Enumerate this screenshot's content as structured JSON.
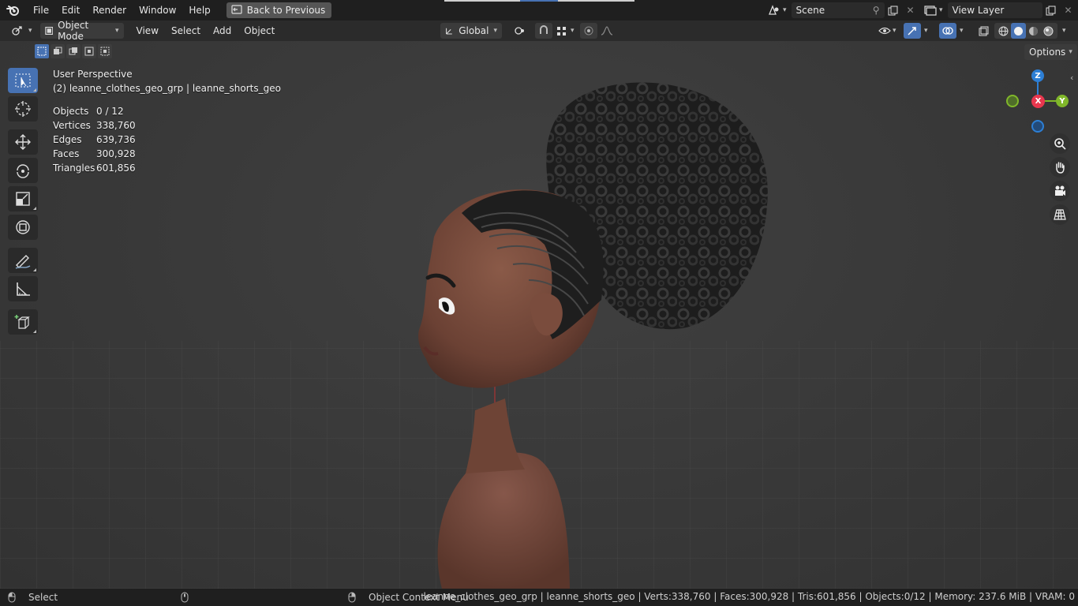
{
  "menu": {
    "items": [
      "File",
      "Edit",
      "Render",
      "Window",
      "Help"
    ],
    "back_button": "Back to Previous"
  },
  "scene": {
    "name": "Scene",
    "view_layer": "View Layer"
  },
  "header": {
    "mode": "Object Mode",
    "menus": [
      "View",
      "Select",
      "Add",
      "Object"
    ],
    "transform_orientation": "Global",
    "options_label": "Options"
  },
  "overlay": {
    "perspective": "User Perspective",
    "active": "(2) leanne_clothes_geo_grp | leanne_shorts_geo",
    "stats": [
      {
        "label": "Objects",
        "value": "0 / 12"
      },
      {
        "label": "Vertices",
        "value": "338,760"
      },
      {
        "label": "Edges",
        "value": "639,736"
      },
      {
        "label": "Faces",
        "value": "300,928"
      },
      {
        "label": "Triangles",
        "value": "601,856"
      }
    ]
  },
  "gizmo": {
    "z": "Z",
    "x": "X",
    "y": "Y"
  },
  "statusbar": {
    "left": "Select",
    "middle": "Object Context Menu",
    "right": "leanne_clothes_geo_grp | leanne_shorts_geo | Verts:338,760 | Faces:300,928 | Tris:601,856 | Objects:0/12 | Memory: 237.6 MiB | VRAM: 0"
  },
  "colors": {
    "accent": "#4772b3",
    "axis_x": "#e8374e",
    "axis_y": "#80b72a",
    "axis_z": "#2d7fd5"
  }
}
